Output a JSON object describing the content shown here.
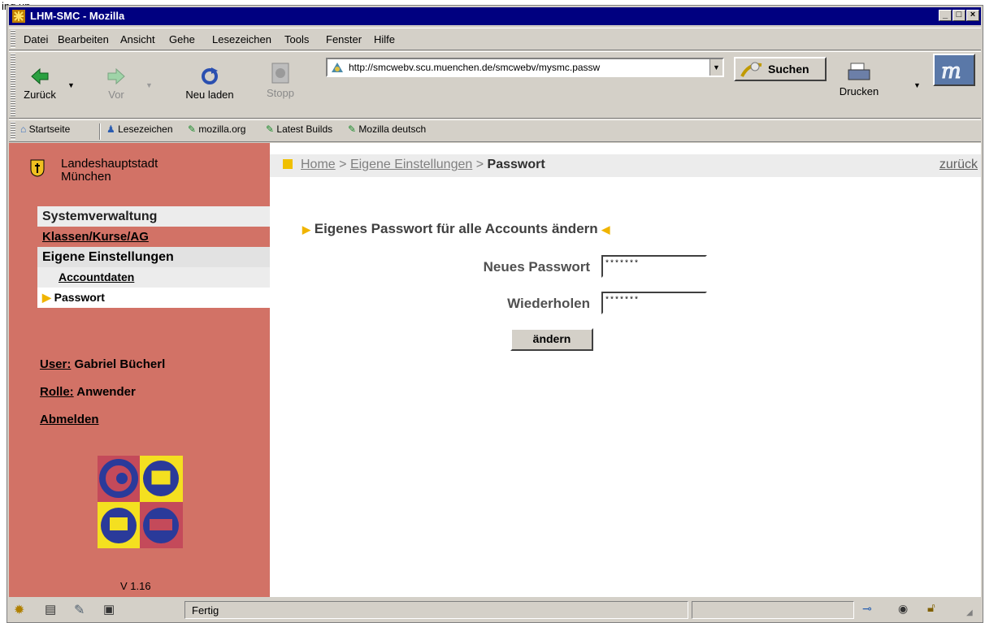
{
  "caption": "ing up",
  "window": {
    "title": "LHM-SMC - Mozilla"
  },
  "menubar": {
    "items": [
      "Datei",
      "Bearbeiten",
      "Ansicht",
      "Gehe",
      "Lesezeichen",
      "Tools",
      "Fenster",
      "Hilfe"
    ]
  },
  "toolbar": {
    "back_label": "Zurück",
    "forward_label": "Vor",
    "reload_label": "Neu laden",
    "stop_label": "Stopp",
    "url": "http://smcwebv.scu.muenchen.de/smcwebv/mysmc.passw",
    "search_label": "Suchen",
    "print_label": "Drucken"
  },
  "personal_toolbar": {
    "items": [
      "Startseite",
      "Lesezeichen",
      "mozilla.org",
      "Latest Builds",
      "Mozilla deutsch"
    ]
  },
  "sidebar": {
    "city_line1": "Landeshauptstadt",
    "city_line2": "München",
    "nav": [
      "Systemverwaltung",
      "Klassen/Kurse/AG",
      "Eigene Einstellungen",
      "Accountdaten",
      "Passwort"
    ],
    "user_label": "User:",
    "user_value": "Gabriel Bücherl",
    "role_label": "Rolle:",
    "role_value": "Anwender",
    "logout": "Abmelden",
    "version": "V 1.16"
  },
  "content": {
    "breadcrumb": [
      "Home",
      ">",
      "Eigene Einstellungen",
      ">",
      "Passwort"
    ],
    "back_link": "zurück",
    "form_title": "Eigenes Passwort für alle Accounts ändern",
    "new_password_label": "Neues Passwort",
    "new_password_value": "*******",
    "repeat_label": "Wiederholen",
    "repeat_value": "*******",
    "submit": "ändern"
  },
  "statusbar": {
    "status": "Fertig"
  },
  "colors": {
    "sidebar": "#d27266",
    "accent": "#f0b400",
    "titlebar": "#000080"
  }
}
